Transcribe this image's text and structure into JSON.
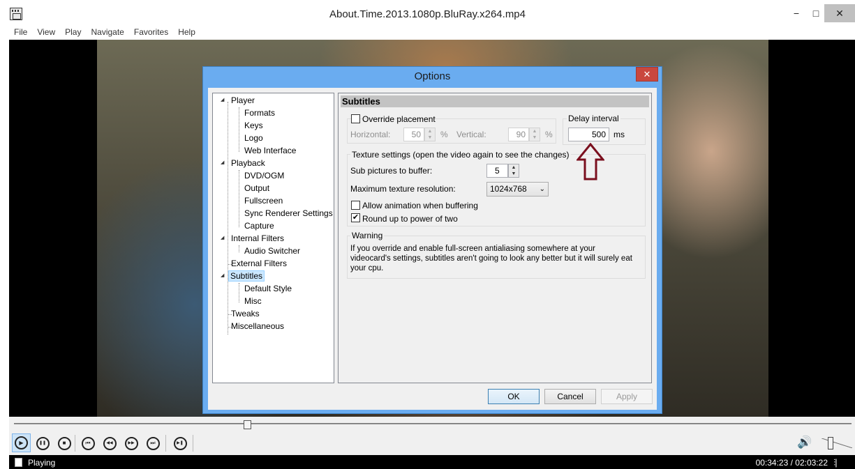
{
  "window": {
    "title": "About.Time.2013.1080p.BluRay.x264.mp4",
    "minimize_glyph": "−",
    "maximize_glyph": "□",
    "close_glyph": "✕"
  },
  "menu": [
    "File",
    "View",
    "Play",
    "Navigate",
    "Favorites",
    "Help"
  ],
  "controls": {
    "play": "▶",
    "pause": "❚❚",
    "stop": "■",
    "prev": "⏮",
    "rewind": "◀◀",
    "forward": "▶▶",
    "next": "⏭",
    "frame_step": "▶❚",
    "volume_icon": "🔊"
  },
  "seek": {
    "position_fraction": 0.28
  },
  "volume": {
    "level_fraction": 0.25
  },
  "status": {
    "state": "Playing",
    "time": "00:34:23 / 02:03:22",
    "signal_glyph": "⫶|"
  },
  "dialog": {
    "title": "Options",
    "close_glyph": "✕",
    "tree": {
      "player": "Player",
      "formats": "Formats",
      "keys": "Keys",
      "logo": "Logo",
      "web_interface": "Web Interface",
      "playback": "Playback",
      "dvd_ogm": "DVD/OGM",
      "output": "Output",
      "fullscreen": "Fullscreen",
      "sync_renderer": "Sync Renderer Settings",
      "capture": "Capture",
      "internal_filters": "Internal Filters",
      "audio_switcher": "Audio Switcher",
      "external_filters": "External Filters",
      "subtitles": "Subtitles",
      "default_style": "Default Style",
      "misc": "Misc",
      "tweaks": "Tweaks",
      "miscellaneous": "Miscellaneous",
      "toggle_glyph": "◢"
    },
    "panel": {
      "header": "Subtitles",
      "override_placement": {
        "label": "Override placement",
        "checked": false
      },
      "horizontal": {
        "label": "Horizontal:",
        "value": "50",
        "unit": "%"
      },
      "vertical": {
        "label": "Vertical:",
        "value": "90",
        "unit": "%"
      },
      "delay_interval": {
        "label": "Delay interval",
        "value": "500",
        "unit": "ms"
      },
      "texture_group_label": "Texture settings (open the video again to see the changes)",
      "sub_pictures": {
        "label": "Sub pictures to buffer:",
        "value": "5"
      },
      "max_texture": {
        "label": "Maximum texture resolution:",
        "value": "1024x768"
      },
      "allow_animation": {
        "label": "Allow animation when buffering",
        "checked": false,
        "mark": ""
      },
      "round_up": {
        "label": "Round up to power of two",
        "checked": true,
        "mark": "✔"
      },
      "warning_label": "Warning",
      "warning_text": "If you override and enable full-screen antialiasing somewhere at your videocard's settings, subtitles aren't going to look any better but it will surely eat your cpu.",
      "spin_up": "▲",
      "spin_down": "▼",
      "combo_arrow": "⌄"
    },
    "buttons": {
      "ok": "OK",
      "cancel": "Cancel",
      "apply": "Apply"
    }
  },
  "colors": {
    "dialog_frame": "#6aacf0",
    "close_red": "#c9473e",
    "annotation_arrow": "#7a0f1e",
    "selection": "#cce8ff"
  }
}
